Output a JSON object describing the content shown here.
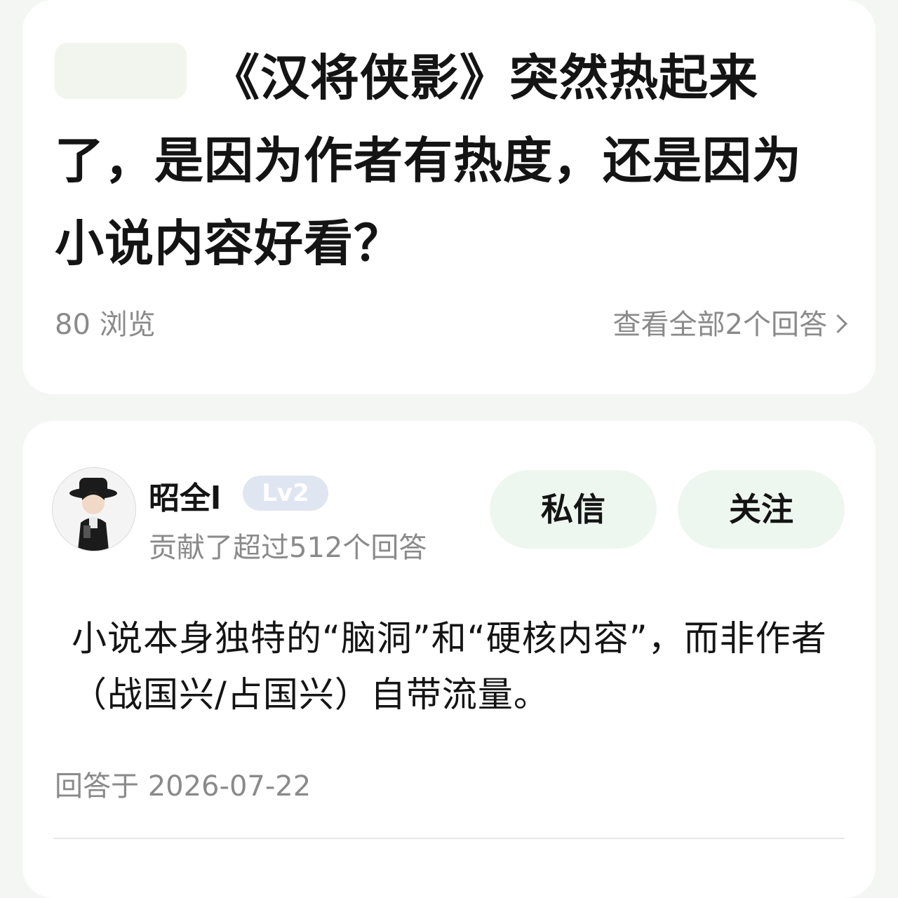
{
  "question": {
    "title": "《汉将侠影》突然热起来了，是因为作者有热度，还是因为小说内容好看？",
    "views": "80 浏览",
    "view_all": "查看全部2个回答"
  },
  "answer": {
    "author": {
      "name": "昭全l",
      "level": "Lv2",
      "subtitle": "贡献了超过512个回答"
    },
    "buttons": {
      "message": "私信",
      "follow": "关注"
    },
    "text": "小说本身独特的“脑洞”和“硬核内容”，而非作者（战国兴/占国兴）自带流量。",
    "date": "回答于 2026-07-22"
  },
  "colors": {
    "page_bg": "#f3f6f2",
    "card_bg": "#ffffff",
    "pill_bg": "#eef7ef",
    "level_badge_bg": "#dfe6f1",
    "muted_text": "#8a8a8a"
  },
  "icons": {
    "view_all": "chevron-right-icon",
    "avatar": "cartoon-avatar-icon"
  }
}
